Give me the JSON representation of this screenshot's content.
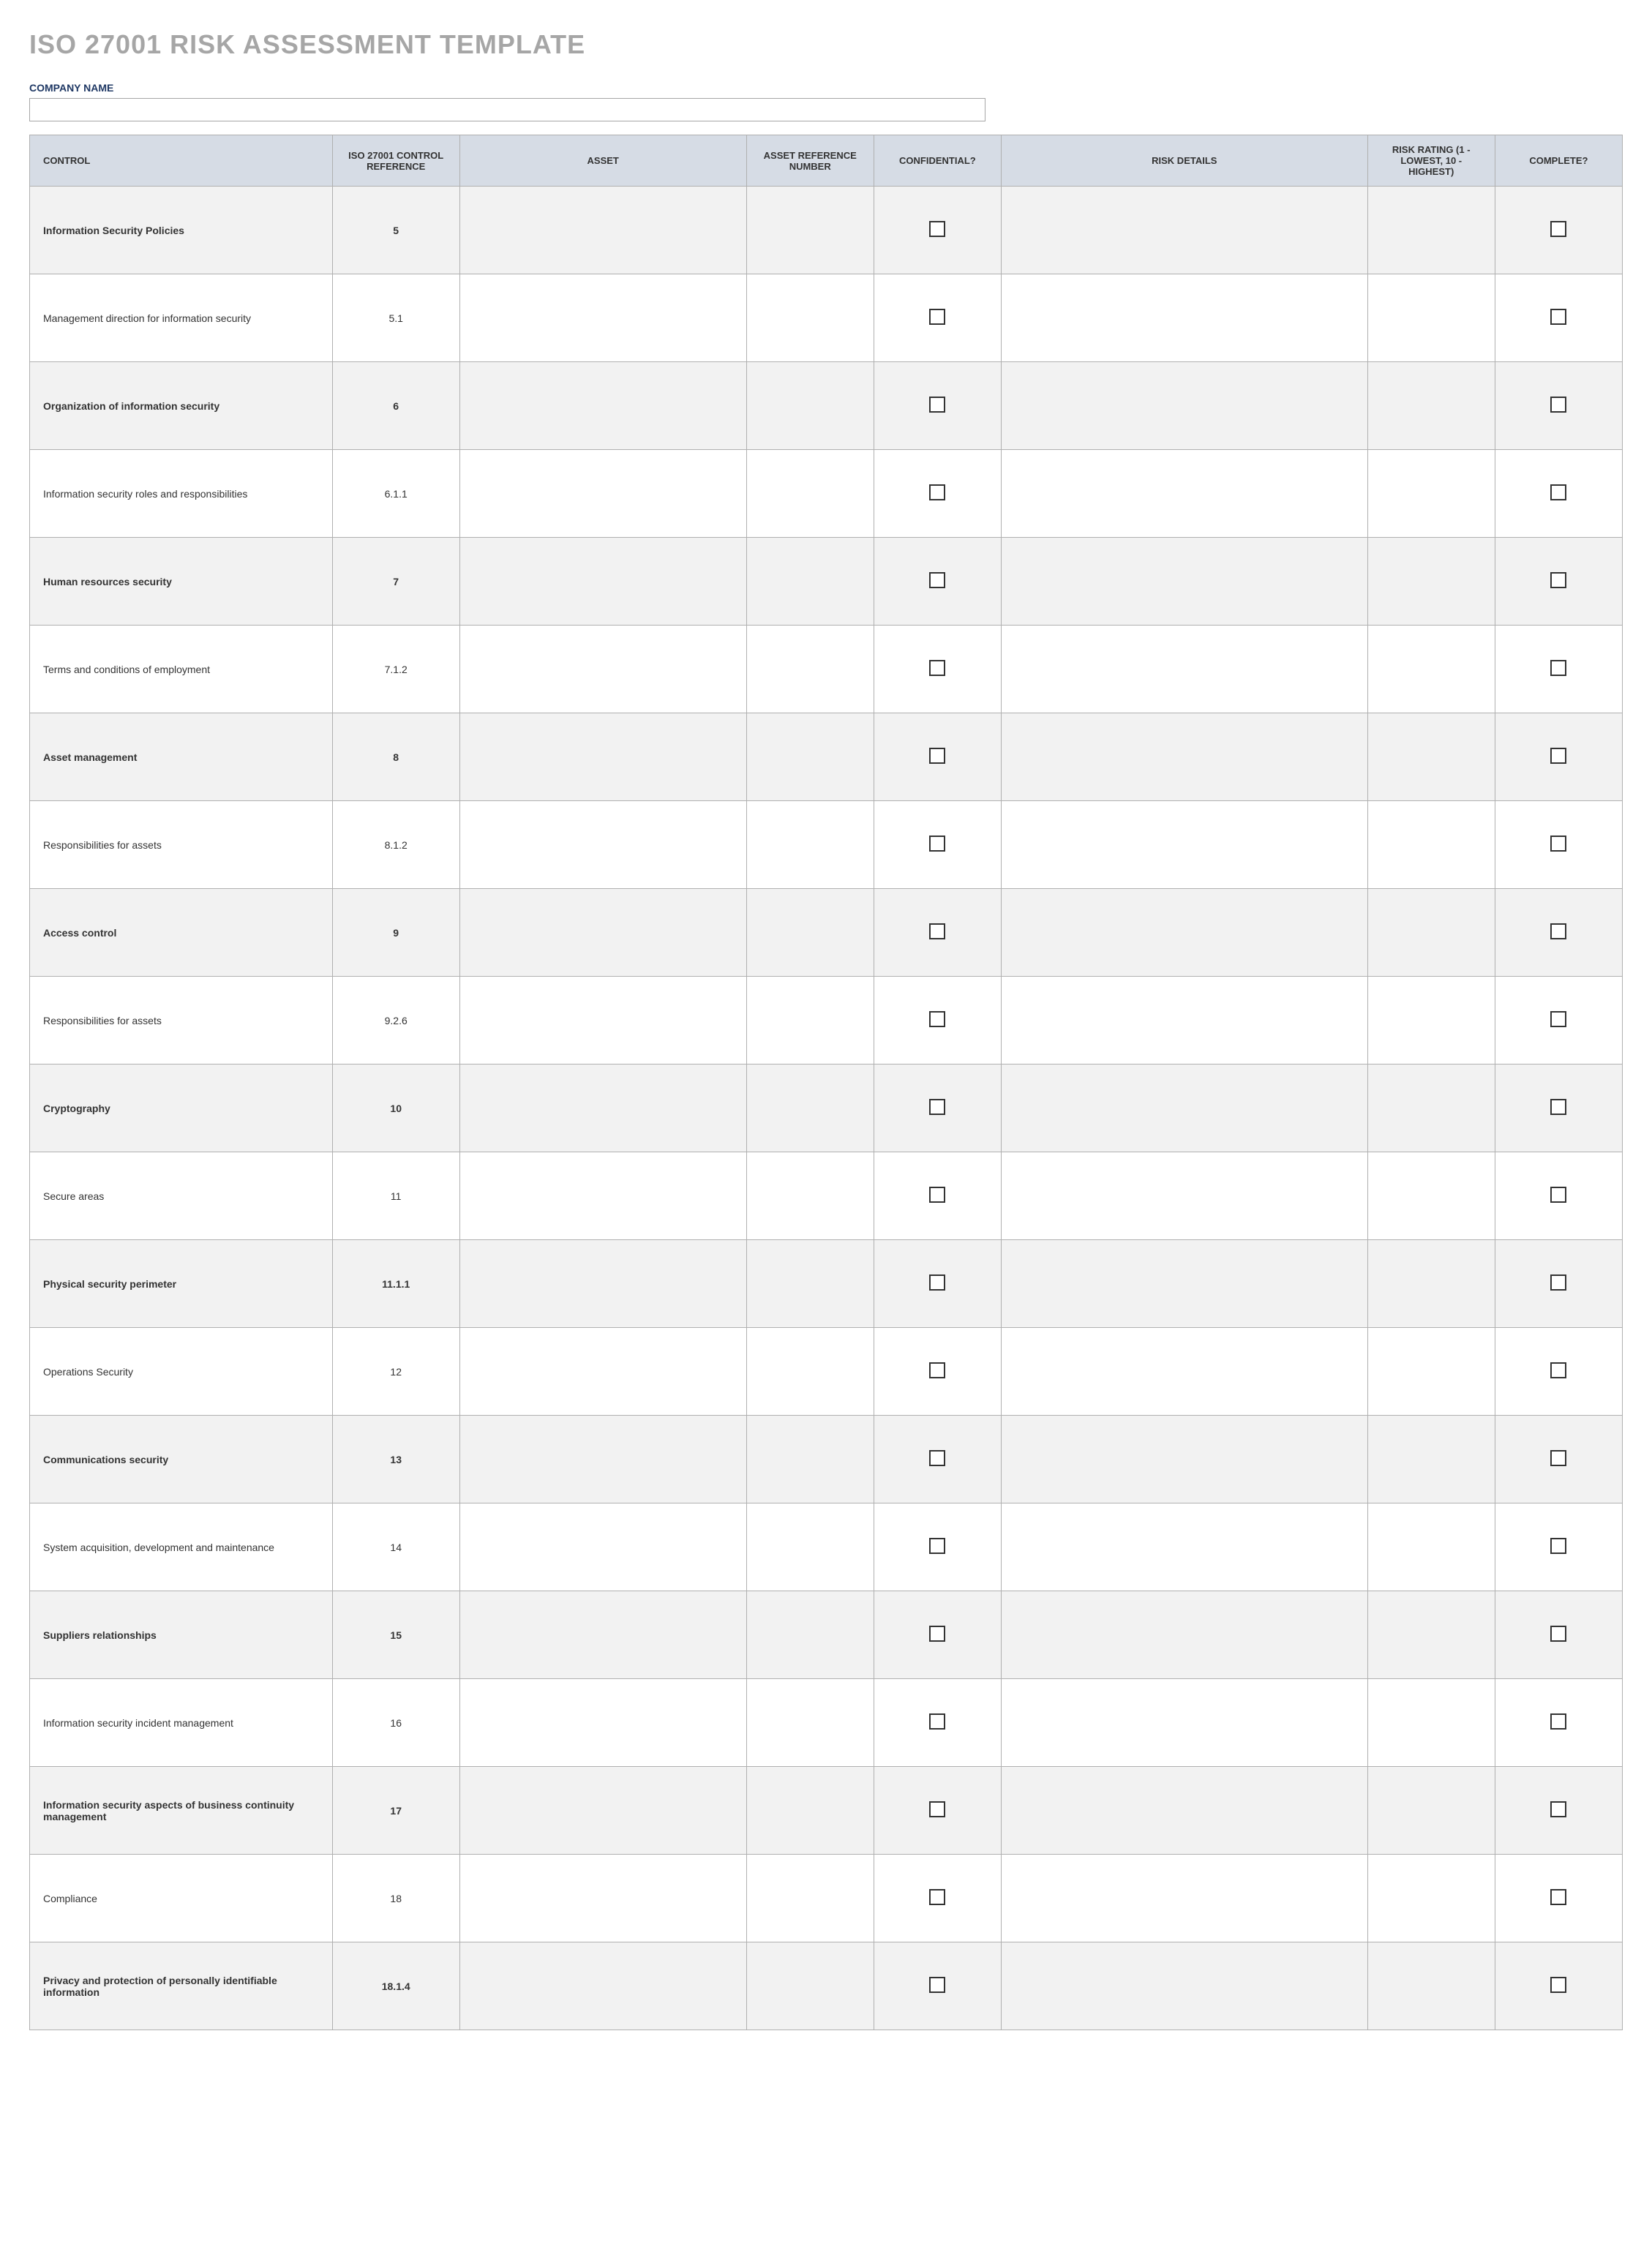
{
  "title": "ISO 27001 RISK ASSESSMENT TEMPLATE",
  "company_name_label": "COMPANY NAME",
  "company_name_value": "",
  "columns": {
    "control": "CONTROL",
    "reference": "ISO 27001 CONTROL REFERENCE",
    "asset": "ASSET",
    "asset_ref": "ASSET REFERENCE NUMBER",
    "confidential": "CONFIDENTIAL?",
    "risk_details": "RISK DETAILS",
    "risk_rating": "RISK RATING (1 - LOWEST, 10 - HIGHEST)",
    "complete": "COMPLETE?"
  },
  "rows": [
    {
      "control": "Information Security Policies",
      "reference": "5",
      "asset": "",
      "asset_ref": "",
      "confidential": false,
      "risk_details": "",
      "risk_rating": "",
      "complete": false,
      "section": true
    },
    {
      "control": "Management direction for information security",
      "reference": "5.1",
      "asset": "",
      "asset_ref": "",
      "confidential": false,
      "risk_details": "",
      "risk_rating": "",
      "complete": false,
      "section": false
    },
    {
      "control": "Organization of information security",
      "reference": "6",
      "asset": "",
      "asset_ref": "",
      "confidential": false,
      "risk_details": "",
      "risk_rating": "",
      "complete": false,
      "section": true
    },
    {
      "control": "Information security roles and responsibilities",
      "reference": "6.1.1",
      "asset": "",
      "asset_ref": "",
      "confidential": false,
      "risk_details": "",
      "risk_rating": "",
      "complete": false,
      "section": false
    },
    {
      "control": "Human resources security",
      "reference": "7",
      "asset": "",
      "asset_ref": "",
      "confidential": false,
      "risk_details": "",
      "risk_rating": "",
      "complete": false,
      "section": true
    },
    {
      "control": "Terms and conditions of employment",
      "reference": "7.1.2",
      "asset": "",
      "asset_ref": "",
      "confidential": false,
      "risk_details": "",
      "risk_rating": "",
      "complete": false,
      "section": false
    },
    {
      "control": "Asset management",
      "reference": "8",
      "asset": "",
      "asset_ref": "",
      "confidential": false,
      "risk_details": "",
      "risk_rating": "",
      "complete": false,
      "section": true
    },
    {
      "control": "Responsibilities for assets",
      "reference": "8.1.2",
      "asset": "",
      "asset_ref": "",
      "confidential": false,
      "risk_details": "",
      "risk_rating": "",
      "complete": false,
      "section": false
    },
    {
      "control": "Access control",
      "reference": "9",
      "asset": "",
      "asset_ref": "",
      "confidential": false,
      "risk_details": "",
      "risk_rating": "",
      "complete": false,
      "section": true
    },
    {
      "control": "Responsibilities for assets",
      "reference": "9.2.6",
      "asset": "",
      "asset_ref": "",
      "confidential": false,
      "risk_details": "",
      "risk_rating": "",
      "complete": false,
      "section": false
    },
    {
      "control": "Cryptography",
      "reference": "10",
      "asset": "",
      "asset_ref": "",
      "confidential": false,
      "risk_details": "",
      "risk_rating": "",
      "complete": false,
      "section": true
    },
    {
      "control": "Secure areas",
      "reference": "11",
      "asset": "",
      "asset_ref": "",
      "confidential": false,
      "risk_details": "",
      "risk_rating": "",
      "complete": false,
      "section": false
    },
    {
      "control": "Physical security perimeter",
      "reference": "11.1.1",
      "asset": "",
      "asset_ref": "",
      "confidential": false,
      "risk_details": "",
      "risk_rating": "",
      "complete": false,
      "section": true
    },
    {
      "control": "Operations Security",
      "reference": "12",
      "asset": "",
      "asset_ref": "",
      "confidential": false,
      "risk_details": "",
      "risk_rating": "",
      "complete": false,
      "section": false
    },
    {
      "control": "Communications security",
      "reference": "13",
      "asset": "",
      "asset_ref": "",
      "confidential": false,
      "risk_details": "",
      "risk_rating": "",
      "complete": false,
      "section": true
    },
    {
      "control": "System acquisition, development and maintenance",
      "reference": "14",
      "asset": "",
      "asset_ref": "",
      "confidential": false,
      "risk_details": "",
      "risk_rating": "",
      "complete": false,
      "section": false
    },
    {
      "control": "Suppliers relationships",
      "reference": "15",
      "asset": "",
      "asset_ref": "",
      "confidential": false,
      "risk_details": "",
      "risk_rating": "",
      "complete": false,
      "section": true
    },
    {
      "control": "Information security incident management",
      "reference": "16",
      "asset": "",
      "asset_ref": "",
      "confidential": false,
      "risk_details": "",
      "risk_rating": "",
      "complete": false,
      "section": false
    },
    {
      "control": "Information security aspects of business continuity management",
      "reference": "17",
      "asset": "",
      "asset_ref": "",
      "confidential": false,
      "risk_details": "",
      "risk_rating": "",
      "complete": false,
      "section": true
    },
    {
      "control": "Compliance",
      "reference": "18",
      "asset": "",
      "asset_ref": "",
      "confidential": false,
      "risk_details": "",
      "risk_rating": "",
      "complete": false,
      "section": false
    },
    {
      "control": "Privacy and protection of personally identifiable information",
      "reference": "18.1.4",
      "asset": "",
      "asset_ref": "",
      "confidential": false,
      "risk_details": "",
      "risk_rating": "",
      "complete": false,
      "section": true
    }
  ]
}
